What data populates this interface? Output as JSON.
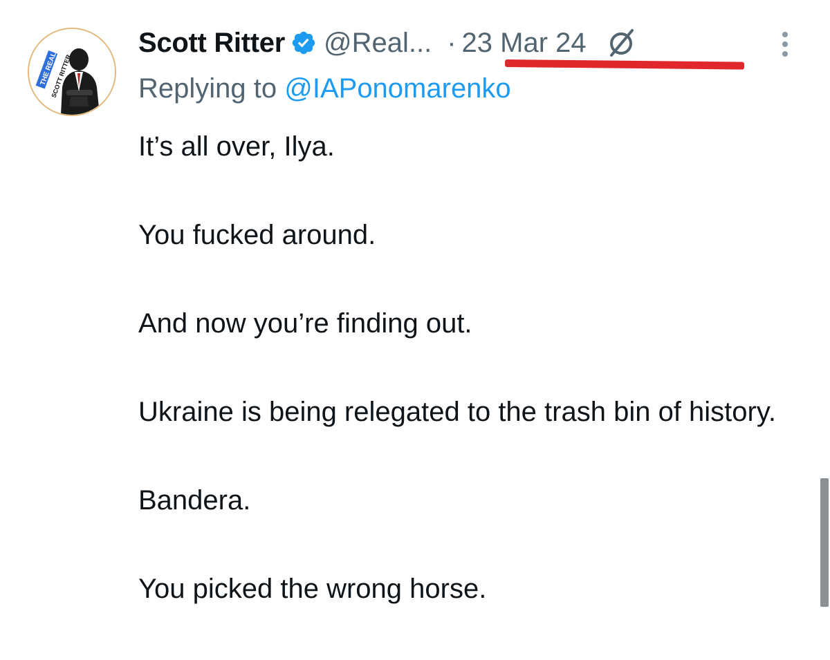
{
  "tweet": {
    "avatar": {
      "badge_text_top": "THE REAL",
      "badge_text_bottom": "SCOTT RITTER"
    },
    "author": {
      "display_name": "Scott Ritter",
      "handle": "@Real...",
      "verified": true,
      "verified_icon": "verified-badge-icon"
    },
    "separator": "·",
    "date": "23 Mar 24",
    "grok_icon": "grok-icon",
    "more_icon": "more-vertical-icon",
    "replying_to": {
      "prefix": "Replying to ",
      "mention": "@IAPonomarenko"
    },
    "paragraphs": [
      "It’s all over, Ilya.",
      "You fucked around.",
      "And now you’re finding out.",
      "Ukraine is being relegated to the trash bin of history.",
      "Bandera.",
      "You picked the wrong horse."
    ]
  },
  "colors": {
    "text": "#0f1419",
    "secondary": "#536471",
    "link": "#1d9bf0",
    "annotation_underline": "#e0282c"
  }
}
